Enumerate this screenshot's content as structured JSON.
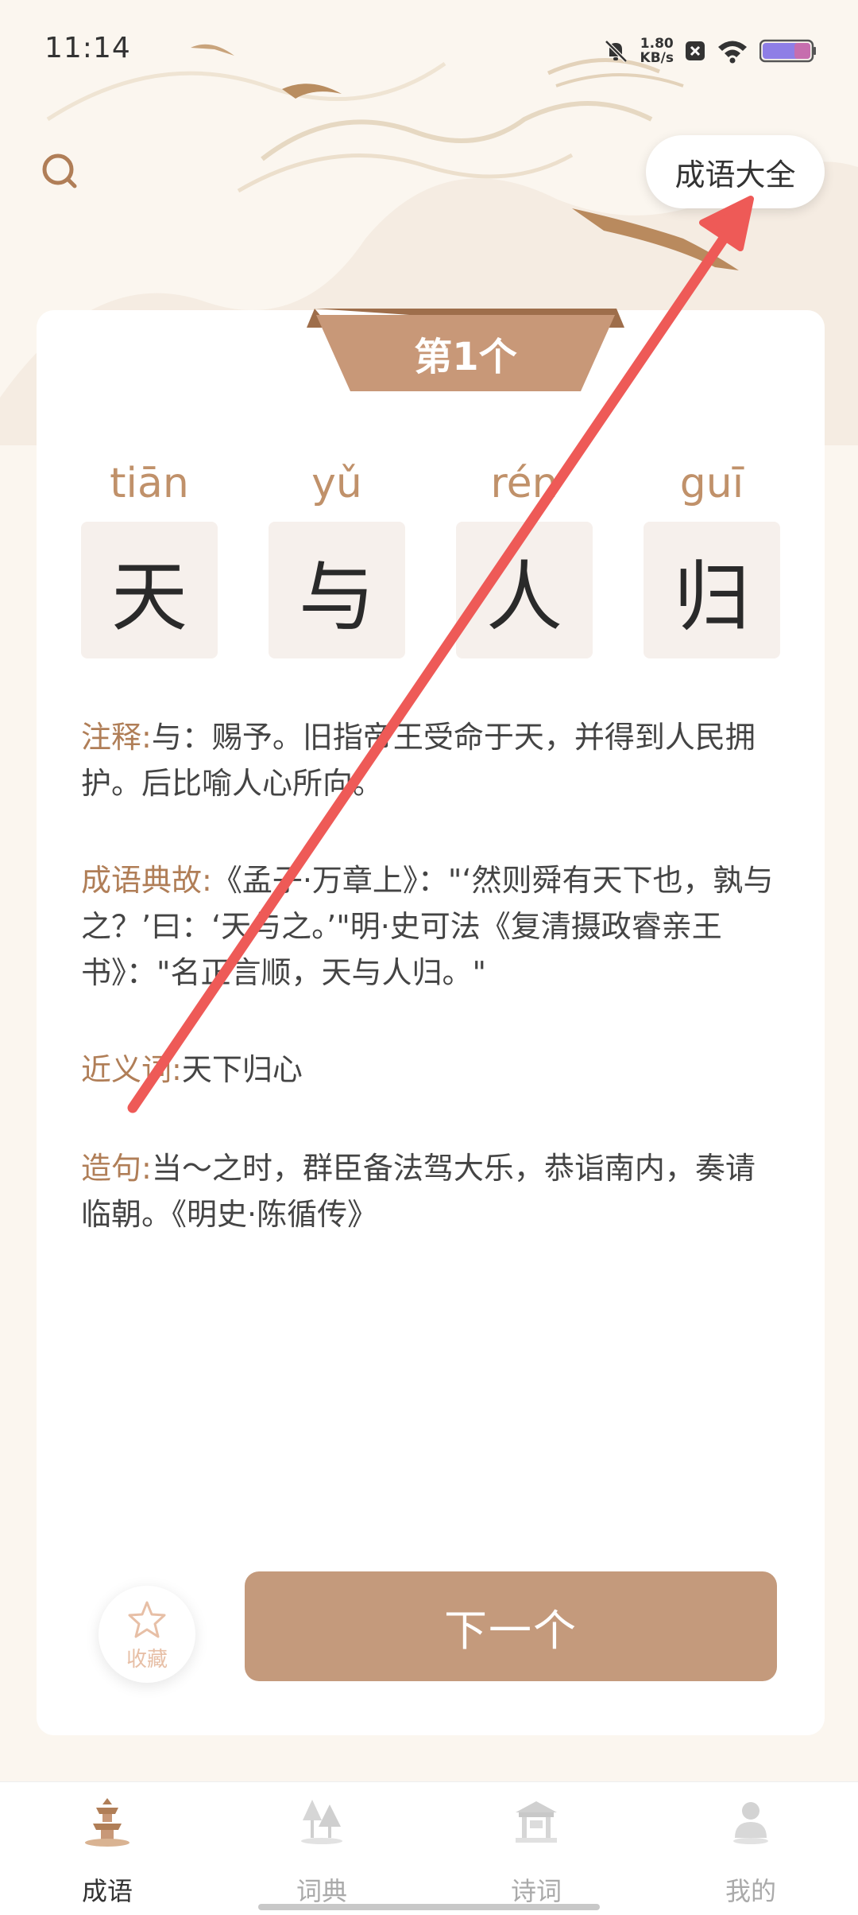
{
  "status_bar": {
    "time": "11:14",
    "net_speed_value": "1.80",
    "net_speed_unit": "KB/s",
    "icons": [
      "bell-muted-icon",
      "notification-close-icon",
      "wifi-icon",
      "battery-icon"
    ]
  },
  "header": {
    "search_icon": "search-icon",
    "idiom_all_label": "成语大全"
  },
  "card": {
    "ribbon_label": "第1个",
    "idiom": [
      {
        "pinyin": "tiān",
        "char": "天"
      },
      {
        "pinyin": "yǔ",
        "char": "与"
      },
      {
        "pinyin": "rén",
        "char": "人"
      },
      {
        "pinyin": "guī",
        "char": "归"
      }
    ],
    "definition_label": "注释:",
    "definition_text": "与：赐予。旧指帝王受命于天，并得到人民拥护。后比喻人心所向。",
    "origin_label": "成语典故:",
    "origin_text": "《孟子·万章上》：\"‘然则舜有天下也，孰与之？’曰：‘天与之。’\"明·史可法《复清摄政睿亲王书》：\"名正言顺，天与人归。\"",
    "synonym_label": "近义词:",
    "synonym_text": "天下归心",
    "example_label": "造句:",
    "example_text": "当～之时，群臣备法驾大乐，恭诣南内，奏请临朝。《明史·陈循传》",
    "favorite_label": "收藏",
    "next_label": "下一个"
  },
  "bottom_nav": {
    "items": [
      {
        "label": "成语",
        "icon": "pagoda-icon",
        "active": true
      },
      {
        "label": "词典",
        "icon": "trees-icon",
        "active": false
      },
      {
        "label": "诗词",
        "icon": "pavilion-icon",
        "active": false
      },
      {
        "label": "我的",
        "icon": "user-icon",
        "active": false
      }
    ]
  },
  "colors": {
    "background": "#fbf6ef",
    "accent": "#c49a7c",
    "label": "#b07e57",
    "annotation_arrow": "#ee5a57"
  }
}
